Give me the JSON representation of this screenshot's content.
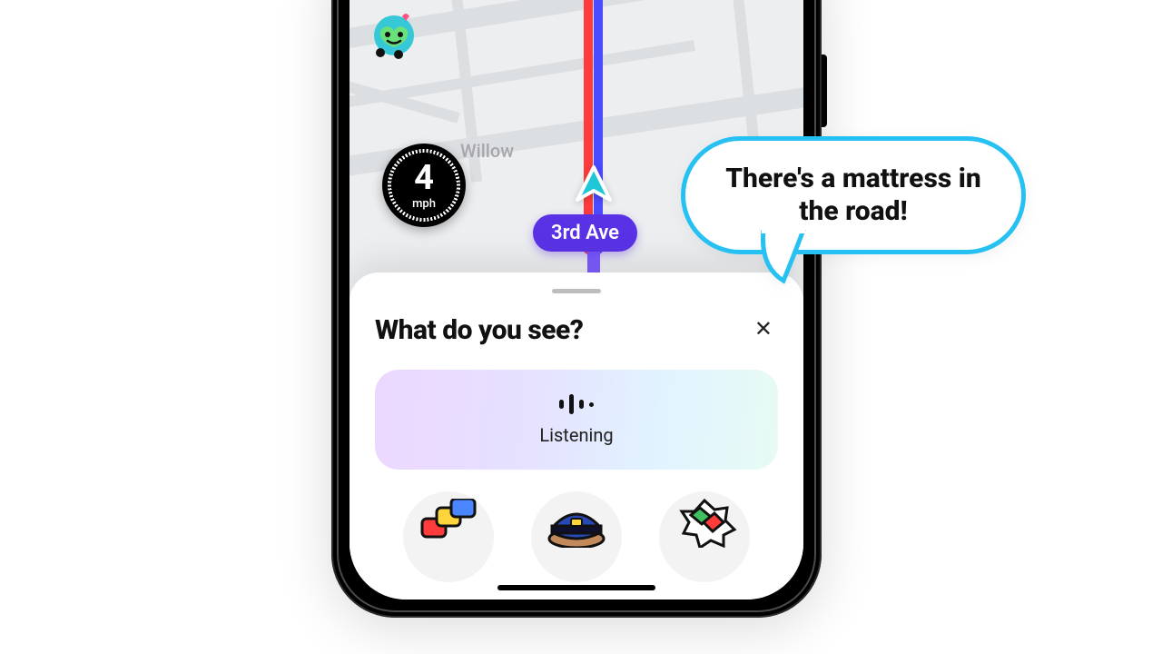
{
  "map": {
    "street_label_1": "Willow",
    "current_street": "3rd Ave"
  },
  "speedometer": {
    "value": "4",
    "unit": "mph"
  },
  "sheet": {
    "title": "What do you see?",
    "listening_label": "Listening"
  },
  "bubble": {
    "text": "There's a mattress in the road!"
  }
}
